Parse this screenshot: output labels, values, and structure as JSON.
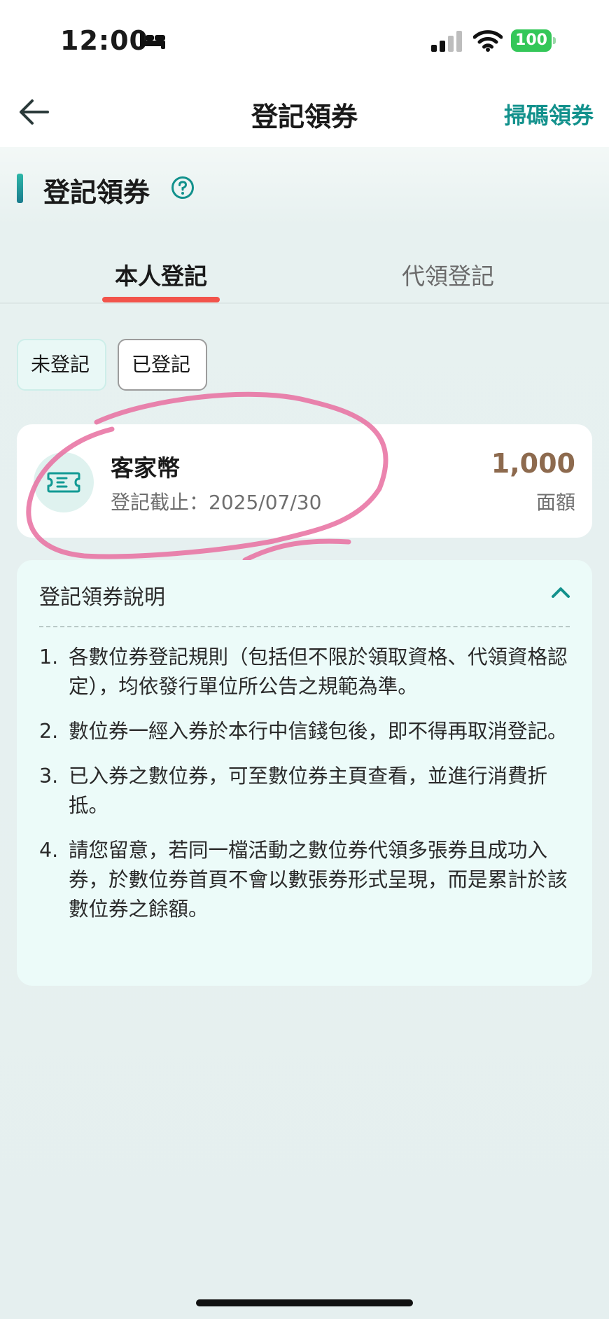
{
  "status_bar": {
    "time": "12:00",
    "battery": "100"
  },
  "nav": {
    "title": "登記領券",
    "action": "掃碼領券"
  },
  "section": {
    "title": "登記領券"
  },
  "tabs": [
    {
      "label": "本人登記",
      "selected": true
    },
    {
      "label": "代領登記",
      "selected": false
    }
  ],
  "filters": [
    {
      "label": "未登記",
      "selected": true
    },
    {
      "label": "已登記",
      "selected": false
    }
  ],
  "coupon": {
    "name": "客家幣",
    "deadline": "登記截止：2025/07/30",
    "amount": "1,000",
    "amount_label": "面額"
  },
  "description": {
    "title": "登記領券說明",
    "items": [
      {
        "num": "1.",
        "text": "各數位券登記規則（包括但不限於領取資格、代領資格認定），均依發行單位所公告之規範為準。"
      },
      {
        "num": "2.",
        "text": "數位券一經入券於本行中信錢包後，即不得再取消登記。"
      },
      {
        "num": "3.",
        "text": "已入券之數位券，可至數位券主頁查看，並進行消費折抵。"
      },
      {
        "num": "4.",
        "text": "請您留意，若同一檔活動之數位券代領多張券且成功入券，於數位券首頁不會以數張券形式呈現，而是累計於該數位券之餘額。"
      }
    ]
  },
  "colors": {
    "accent": "#12918c",
    "tab_indicator": "#f2544b",
    "amount": "#8d6a4e",
    "annotation": "#e86fa0"
  },
  "icons": [
    "bed-icon",
    "signal-icon",
    "wifi-icon",
    "back-arrow-icon",
    "help-icon",
    "ticket-icon",
    "chevron-up-icon"
  ]
}
